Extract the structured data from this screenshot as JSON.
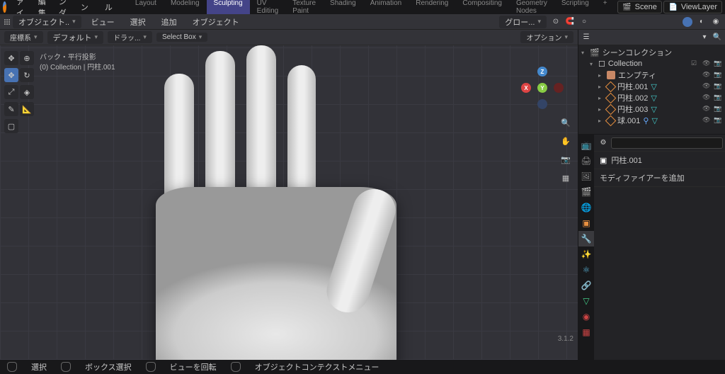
{
  "top_menu": [
    "ファイル",
    "編集",
    "レンダー",
    "ウィンドウ",
    "ヘルプ"
  ],
  "workspace_tabs": [
    "Layout",
    "Modeling",
    "Sculpting",
    "UV Editing",
    "Texture Paint",
    "Shading",
    "Animation",
    "Rendering",
    "Compositing",
    "Geometry Nodes",
    "Scripting"
  ],
  "active_workspace": "Sculpting",
  "scene_name": "Scene",
  "viewlayer_name": "ViewLayer",
  "row2": {
    "mode": "オブジェクト..",
    "menus": [
      "ビュー",
      "選択",
      "追加",
      "オブジェクト"
    ],
    "global": "グロー..."
  },
  "vp_header": {
    "coord": "座標系",
    "default": "デフォルト",
    "drag": "ドラッ...",
    "select_box": "Select Box",
    "options": "オプション"
  },
  "overlay": {
    "title": "バック・平行投影",
    "sub": "(0) Collection | 円柱.001"
  },
  "gizmo": {
    "x": "X",
    "y": "Y",
    "z": "Z"
  },
  "outliner": {
    "root": "シーンコレクション",
    "collection": "Collection",
    "items": [
      {
        "name": "エンプティ",
        "type": "empty"
      },
      {
        "name": "円柱.001",
        "type": "mesh",
        "extra": true
      },
      {
        "name": "円柱.002",
        "type": "mesh",
        "extra": true
      },
      {
        "name": "円柱.003",
        "type": "mesh",
        "extra": true
      },
      {
        "name": "球.001",
        "type": "mesh",
        "extra": true
      }
    ]
  },
  "props": {
    "active_object": "円柱.001",
    "add_modifier": "モディファイアーを追加"
  },
  "statusbar": {
    "select": "選択",
    "box_select": "ボックス選択",
    "rotate_view": "ビューを回転",
    "context_menu": "オブジェクトコンテクストメニュー"
  },
  "version": "3.1.2"
}
